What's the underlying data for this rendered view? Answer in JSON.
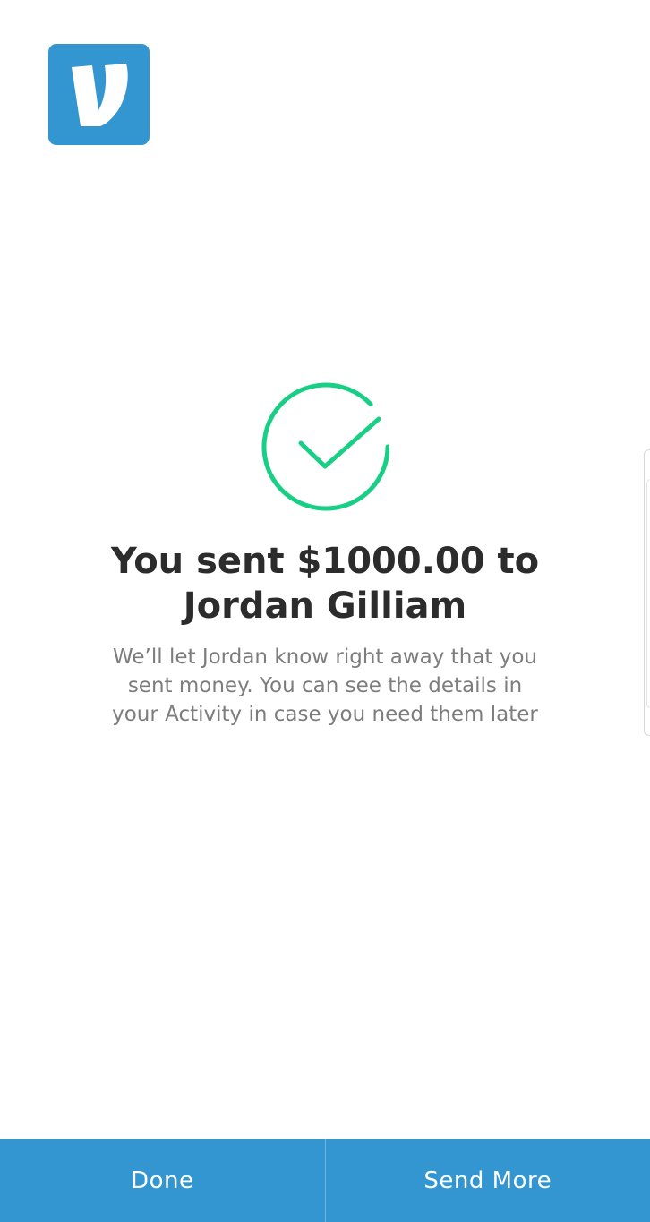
{
  "logo": {
    "icon": "venmo-v-icon",
    "color": "#3396D0"
  },
  "confirmation": {
    "icon": "checkmark-circle-icon",
    "icon_color": "#19CF86",
    "title_line1": "You sent $1000.00 to",
    "title_line2": "Jordan Gilliam",
    "message_line1": "We’ll let Jordan know right away that you",
    "message_line2": "sent money. You can see the details in",
    "message_line3": "your Activity in case you need them later"
  },
  "footer": {
    "background": "#3396D0",
    "done_label": "Done",
    "send_more_label": "Send More"
  }
}
